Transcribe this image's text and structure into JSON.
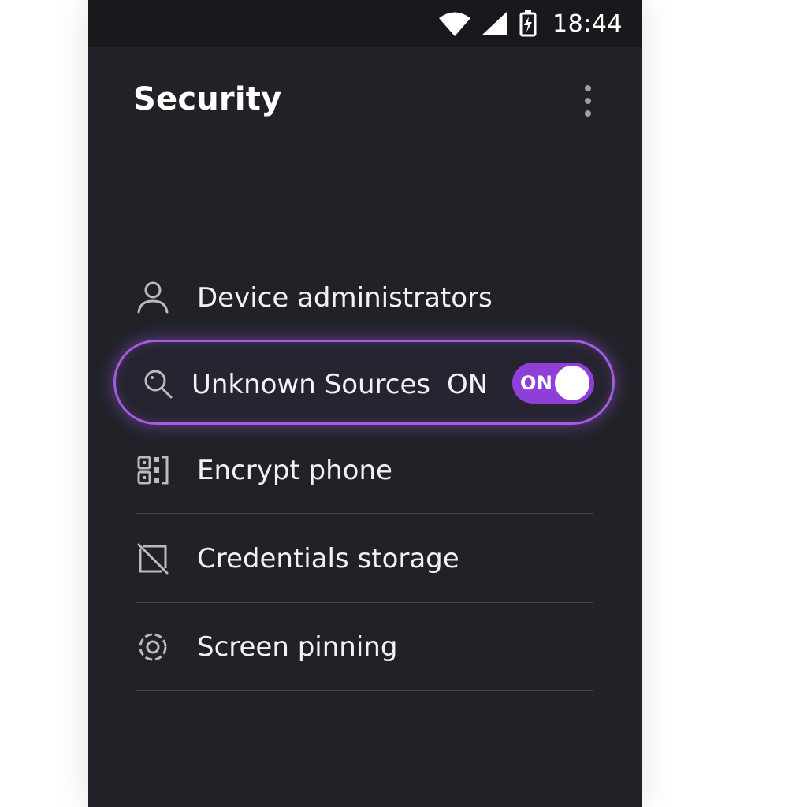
{
  "status_bar": {
    "time": "18:44"
  },
  "header": {
    "title": "Security"
  },
  "settings": {
    "device_admins": {
      "label": "Device administrators",
      "icon": "person-icon"
    },
    "unknown_sources": {
      "label": "Unknown Sources",
      "state": "ON",
      "toggle_label": "ON",
      "enabled": true,
      "icon": "search-icon"
    },
    "encrypt_phone": {
      "label": "Encrypt phone",
      "icon": "encrypt-icon"
    },
    "credentials_storage": {
      "label": "Credentials storage",
      "icon": "credentials-icon"
    },
    "screen_pinning": {
      "label": "Screen pinning",
      "icon": "gear-icon"
    }
  },
  "colors": {
    "accent": "#8e3fd8",
    "highlight_border": "#a35ce0",
    "background": "#212228"
  }
}
